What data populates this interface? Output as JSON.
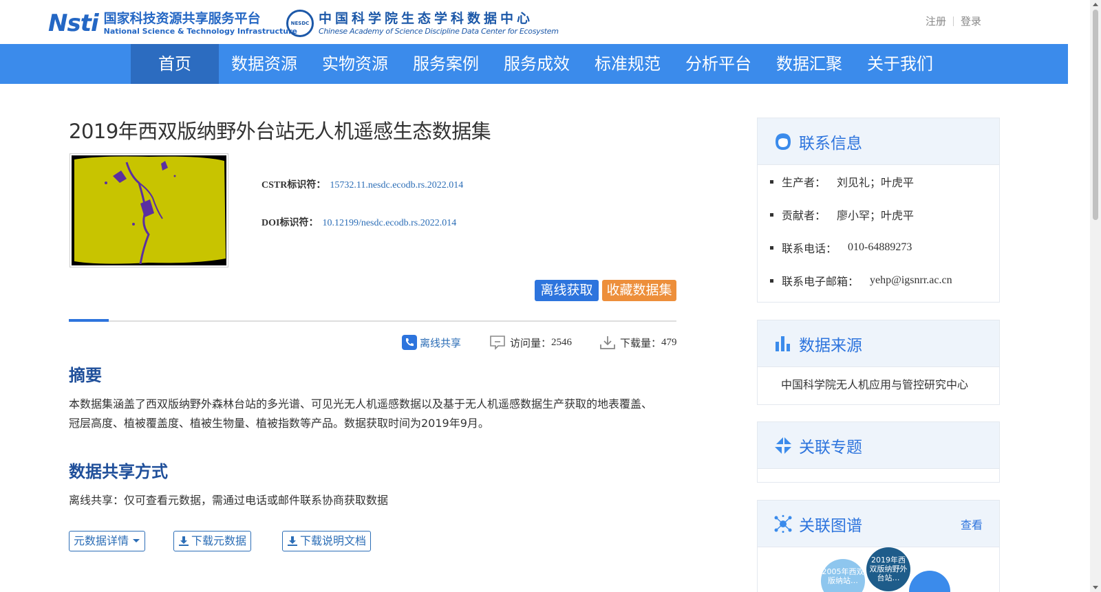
{
  "header": {
    "logo1_mark": "Nsti",
    "logo1_cn": "国家科技资源共享服务平台",
    "logo1_en": "National Science & Technology Infrastructure",
    "logo2_seal": "NESDC",
    "logo2_cn": "中国科学院生态学科数据中心",
    "logo2_en": "Chinese Academy of Science Discipline Data Center for Ecosystem",
    "register": "注册",
    "login": "登录"
  },
  "nav": {
    "items": [
      "首页",
      "数据资源",
      "实物资源",
      "服务案例",
      "服务成效",
      "标准规范",
      "分析平台",
      "数据汇聚",
      "关于我们"
    ],
    "active_index": 0
  },
  "dataset": {
    "title": "2019年西双版纳野外台站无人机遥感生态数据集",
    "cstr_label": "CSTR标识符：",
    "cstr_value": "15732.11.nesdc.ecodb.rs.2022.014",
    "doi_label": "DOI标识符：",
    "doi_value": "10.12199/nesdc.ecodb.rs.2022.014",
    "offline_button": "离线获取",
    "favorite_button": "收藏数据集",
    "share_mode": "离线共享",
    "visits_label": "访问量：",
    "visits": "2546",
    "downloads_label": "下载量：",
    "downloads": "479"
  },
  "abstract": {
    "heading": "摘要",
    "text": "本数据集涵盖了西双版纳野外森林台站的多光谱、可见光无人机遥感数据以及基于无人机遥感数据生产获取的地表覆盖、冠层高度、植被覆盖度、植被生物量、植被指数等产品。数据获取时间为2019年9月。"
  },
  "sharing": {
    "heading": "数据共享方式",
    "text": "离线共享：仅可查看元数据，需通过电话或邮件联系协商获取数据"
  },
  "actions": {
    "metadata_detail": "元数据详情",
    "download_metadata": "下载元数据",
    "download_doc": "下载说明文档"
  },
  "contact": {
    "title": "联系信息",
    "items": [
      {
        "label": "生产者：",
        "value": "刘见礼；叶虎平"
      },
      {
        "label": "贡献者：",
        "value": "廖小罕；叶虎平"
      },
      {
        "label": "联系电话：",
        "value": "010-64889273"
      },
      {
        "label": "联系电子邮箱：",
        "value": "yehp@igsnrr.ac.cn"
      }
    ]
  },
  "source": {
    "title": "数据来源",
    "text": "中国科学院无人机应用与管控研究中心"
  },
  "topics": {
    "title": "关联专题"
  },
  "graph": {
    "title": "关联图谱",
    "view_label": "查看",
    "nodes": [
      "2005年西双版纳站…",
      "2019年西双版纳野外台站…"
    ]
  },
  "colors": {
    "nav_bg": "#3b8beb",
    "nav_active": "#2c6cc0",
    "primary_button": "#2d74dd",
    "favorite_button": "#ed8f3b",
    "heading_blue": "#1f4f9a"
  }
}
